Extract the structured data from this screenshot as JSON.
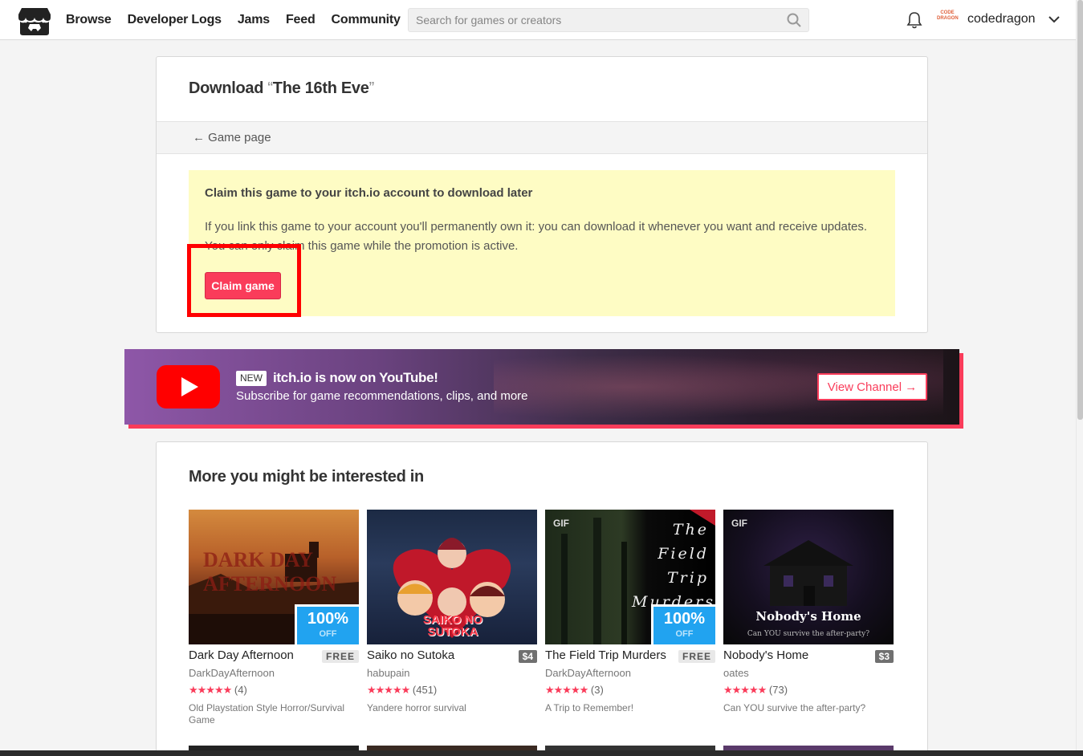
{
  "header": {
    "nav": [
      "Browse",
      "Developer Logs",
      "Jams",
      "Feed",
      "Community"
    ],
    "search_placeholder": "Search for games or creators",
    "username": "codedragon",
    "avatar_text": "CODE DRAGON"
  },
  "download": {
    "title_prefix": "Download ",
    "title_open_quote": "“",
    "game_name": "The 16th Eve",
    "title_close_quote": "”",
    "back_link": "← Game page",
    "claim_heading": "Claim this game to your itch.io account to download later",
    "claim_text": "If you link this game to your account you'll permanently own it: you can download it whenever you want and receive updates. You can only claim this game while the promotion is active.",
    "claim_button": "Claim game"
  },
  "youtube": {
    "badge": "NEW",
    "title": "itch.io is now on YouTube!",
    "subtitle": "Subscribe for game recommendations, clips, and more",
    "button": "View Channel →"
  },
  "recommendations": {
    "heading": "More you might be interested in",
    "games": [
      {
        "title": "Dark Day Afternoon",
        "price": "FREE",
        "author": "DarkDayAfternoon",
        "stars": "★★★★★",
        "count": "(4)",
        "desc": "Old Playstation Style Horror/Survival Game",
        "sale_pct": "100%",
        "sale_off": "OFF",
        "thumb_text": "DARK DAY AFTERNOON"
      },
      {
        "title": "Saiko no Sutoka",
        "price": "$4",
        "author": "habupain",
        "stars": "★★★★★",
        "count": "(451)",
        "desc": "Yandere horror survival",
        "thumb_text": "SAIKO NO SUTOKA"
      },
      {
        "title": "The Field Trip Murders",
        "price": "FREE",
        "author": "DarkDayAfternoon",
        "stars": "★★★★★",
        "count": "(3)",
        "desc": "A Trip to Remember!",
        "gif": "GIF",
        "sale_pct": "100%",
        "sale_off": "OFF",
        "thumb_text": "The Field Trip Murders"
      },
      {
        "title": "Nobody's Home",
        "price": "$3",
        "author": "oates",
        "stars": "★★★★★",
        "count": "(73)",
        "desc": "Can YOU survive the after-party?",
        "gif": "GIF",
        "thumb_title": "Nobody's Home",
        "thumb_sub": "Can YOU survive the after-party?"
      }
    ]
  },
  "colors": {
    "accent": "#fa3c5a",
    "claim_bg": "#fefcc4",
    "sale_blue": "#21a3f0",
    "highlight": "#ff0000"
  }
}
